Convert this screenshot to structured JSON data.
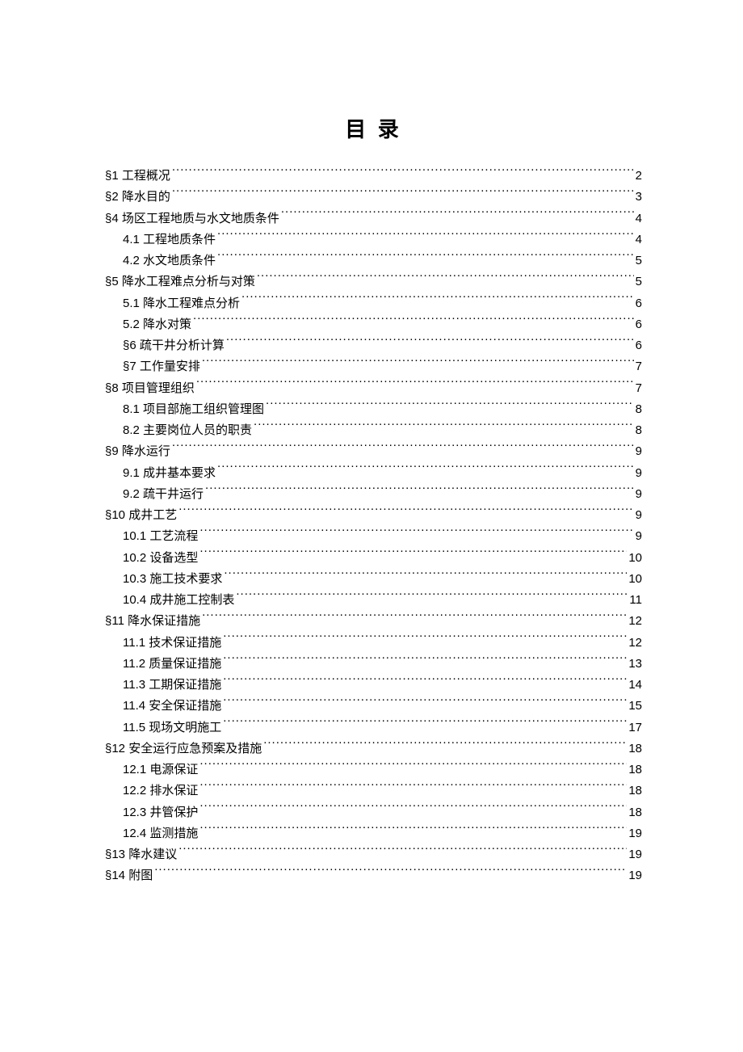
{
  "title": "目 录",
  "entries": [
    {
      "label": "§1  工程概况",
      "page": "2",
      "level": 0
    },
    {
      "label": "§2  降水目的",
      "page": "3",
      "level": 0
    },
    {
      "label": "§4  场区工程地质与水文地质条件",
      "page": "4",
      "level": 0
    },
    {
      "label": "4.1 工程地质条件",
      "page": "4",
      "level": 1
    },
    {
      "label": "4.2 水文地质条件",
      "page": "5",
      "level": 1
    },
    {
      "label": "§5  降水工程难点分析与对策",
      "page": "5",
      "level": 0
    },
    {
      "label": "5.1 降水工程难点分析",
      "page": "6",
      "level": 1
    },
    {
      "label": "5.2 降水对策",
      "page": "6",
      "level": 1
    },
    {
      "label": "§6 疏干井分析计算",
      "page": "6",
      "level": 1
    },
    {
      "label": "§7 工作量安排",
      "page": "7",
      "level": 1
    },
    {
      "label": "§8  项目管理组织",
      "page": "7",
      "level": 0
    },
    {
      "label": "8.1 项目部施工组织管理图",
      "page": "8",
      "level": 1
    },
    {
      "label": "8.2 主要岗位人员的职责",
      "page": "8",
      "level": 1
    },
    {
      "label": "§9  降水运行",
      "page": "9",
      "level": 0
    },
    {
      "label": "9.1 成井基本要求",
      "page": "9",
      "level": 1
    },
    {
      "label": "9.2 疏干井运行",
      "page": "9",
      "level": 1
    },
    {
      "label": "§10  成井工艺",
      "page": "9",
      "level": 0
    },
    {
      "label": "10.1 工艺流程",
      "page": "9",
      "level": 1
    },
    {
      "label": "10.2 设备选型",
      "page": "10",
      "level": 1
    },
    {
      "label": "10.3 施工技术要求",
      "page": "10",
      "level": 1
    },
    {
      "label": "10.4 成井施工控制表",
      "page": "11",
      "level": 1
    },
    {
      "label": "§11  降水保证措施",
      "page": "12",
      "level": 0
    },
    {
      "label": "11.1 技术保证措施",
      "page": "12",
      "level": 1
    },
    {
      "label": "11.2 质量保证措施",
      "page": "13",
      "level": 1
    },
    {
      "label": "11.3 工期保证措施",
      "page": "14",
      "level": 1
    },
    {
      "label": "11.4 安全保证措施",
      "page": "15",
      "level": 1
    },
    {
      "label": "11.5 现场文明施工",
      "page": "17",
      "level": 1
    },
    {
      "label": "§12  安全运行应急预案及措施",
      "page": "18",
      "level": 0
    },
    {
      "label": "12.1 电源保证",
      "page": "18",
      "level": 1
    },
    {
      "label": "12.2 排水保证",
      "page": "18",
      "level": 1
    },
    {
      "label": "12.3 井管保护",
      "page": "18",
      "level": 1
    },
    {
      "label": "12.4 监测措施",
      "page": "19",
      "level": 1
    },
    {
      "label": "§13  降水建议",
      "page": "19",
      "level": 0
    },
    {
      "label": "§14  附图",
      "page": "19",
      "level": 0
    }
  ]
}
